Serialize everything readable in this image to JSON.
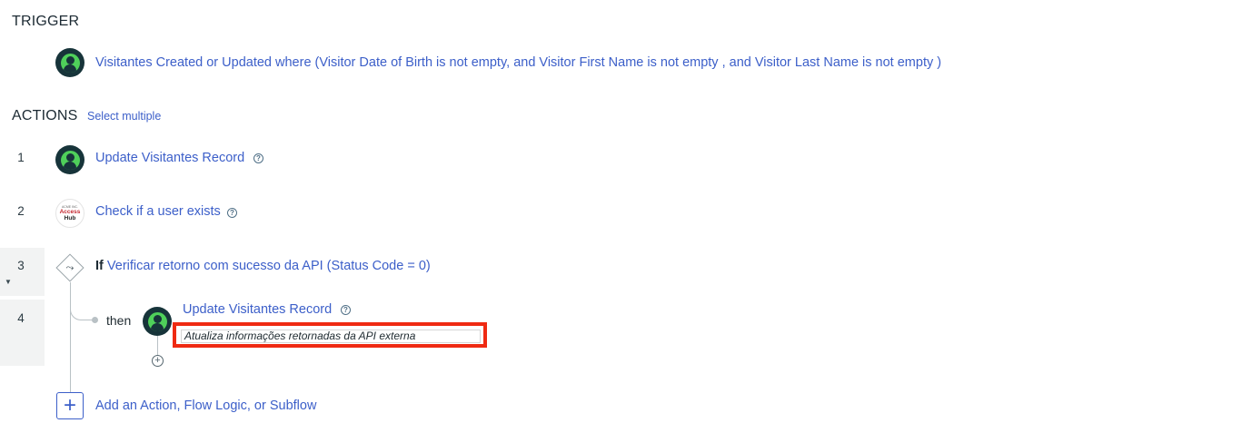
{
  "trigger": {
    "heading": "TRIGGER",
    "description": "Visitantes Created or Updated where (Visitor Date of Birth is not empty, and Visitor First Name is not empty , and Visitor Last Name is not empty )"
  },
  "actions": {
    "heading": "ACTIONS",
    "select_multiple": "Select multiple",
    "items": [
      {
        "number": "1",
        "label": "Update Visitantes Record",
        "icon": "visitor-icon"
      },
      {
        "number": "2",
        "label": "Check if a user exists",
        "icon": "access-hub-icon"
      },
      {
        "number": "3",
        "keyword": "If",
        "label": "Verificar retorno com sucesso da API (Status Code = 0)",
        "icon": "flow-logic-icon"
      },
      {
        "number": "4",
        "branch_label": "then",
        "label": "Update Visitantes Record",
        "annotation": "Atualiza informações retornadas da API externa",
        "icon": "visitor-icon"
      }
    ],
    "add_label": "Add an Action, Flow Logic, or Subflow"
  },
  "access_hub_logo": {
    "line1": "ACME INC.",
    "line2": "Access",
    "line3": "Hub"
  },
  "colors": {
    "link": "#3c5fc9",
    "highlight_box": "#ef2a12",
    "icon_green": "#4fd05a",
    "icon_dark": "#17343a"
  }
}
